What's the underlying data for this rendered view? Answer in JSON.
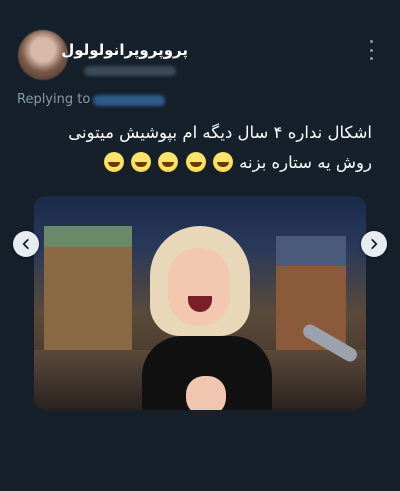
{
  "tweet": {
    "author_name": "پروپروپرانولولول",
    "reply_label": "Replying to",
    "text_line1": "اشکال نداره ۴ سال دیگه ام بپوشیش میتونی",
    "text_line2": "روش یه ستاره بزنه"
  },
  "icons": {
    "more": "more-vertical-icon",
    "prev": "chevron-left-icon",
    "next": "chevron-right-icon",
    "emoji": "laughing-face-icon"
  },
  "colors": {
    "background": "#15202b",
    "secondary_text": "#8899a6",
    "link": "#1d9bf0"
  }
}
